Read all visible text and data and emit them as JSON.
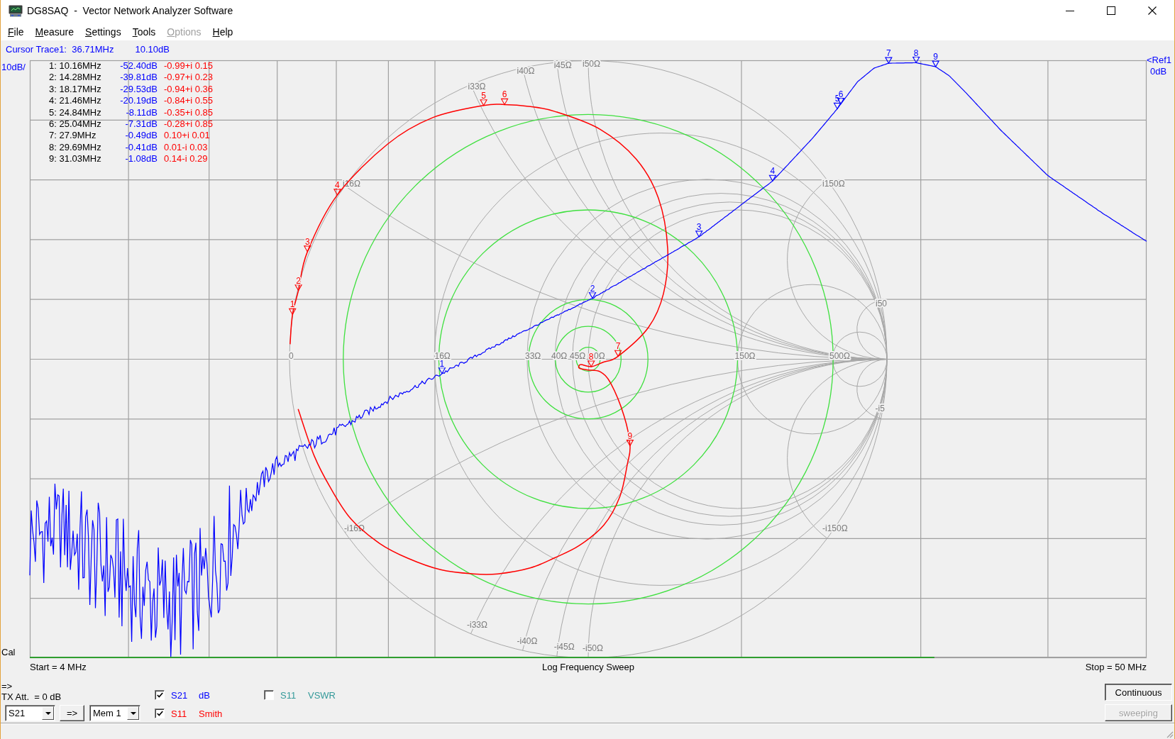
{
  "window": {
    "title": "DG8SAQ  -  Vector Network Analyzer Software"
  },
  "menu": [
    {
      "label": "File",
      "disabled": false
    },
    {
      "label": "Measure",
      "disabled": false
    },
    {
      "label": "Settings",
      "disabled": false
    },
    {
      "label": "Tools",
      "disabled": false
    },
    {
      "label": "Options",
      "disabled": true
    },
    {
      "label": "Help",
      "disabled": false
    }
  ],
  "cursor": {
    "label": "Cursor Trace1:  36.71MHz",
    "value": "10.10dB"
  },
  "axes": {
    "scale": "10dB/",
    "reference": [
      "<Ref1",
      "0dB"
    ],
    "cal": "Cal"
  },
  "marker_table": {
    "rows": [
      {
        "column_1": "1: 10.16MHz",
        "column_2": "-52.40dB",
        "column_3": "-0.99+i 0.15"
      },
      {
        "column_1": "2: 14.28MHz",
        "column_2": "-39.81dB",
        "column_3": "-0.97+i 0.23"
      },
      {
        "column_1": "3: 18.17MHz",
        "column_2": "-29.53dB",
        "column_3": "-0.94+i 0.36"
      },
      {
        "column_1": "4: 21.46MHz",
        "column_2": "-20.19dB",
        "column_3": "-0.84+i 0.55"
      },
      {
        "column_1": "5: 24.84MHz",
        "column_2": "-8.11dB",
        "column_3": "-0.35+i 0.85"
      },
      {
        "column_1": "6: 25.04MHz",
        "column_2": "-7.31dB",
        "column_3": "-0.28+i 0.85"
      },
      {
        "column_1": "7: 27.9MHz",
        "column_2": "-0.49dB",
        "column_3": "0.10+i 0.01"
      },
      {
        "column_1": "8: 29.69MHz",
        "column_2": "-0.41dB",
        "column_3": "0.01-i 0.03"
      },
      {
        "column_1": "9: 31.03MHz",
        "column_2": "-1.08dB",
        "column_3": "0.14-i 0.29"
      }
    ]
  },
  "plot": {
    "s21_markers": [
      "1",
      "2",
      "3",
      "4",
      "5",
      "6",
      "7",
      "8",
      "9"
    ],
    "s11_markers": [
      "1",
      "2",
      "3",
      "4",
      "5",
      "6",
      "7",
      "8",
      "9"
    ],
    "impedance_labels": {
      "real": [
        "0",
        "16Ω",
        "33Ω",
        "40Ω",
        "45Ω",
        "0Ω",
        "150Ω",
        "500Ω"
      ],
      "reactance": [
        "i16Ω",
        "i33Ω",
        "i40Ω",
        "i45Ω",
        "i50Ω",
        "i150Ω",
        "i50",
        "-i16Ω",
        "-i33Ω",
        "-i40Ω",
        "-i45Ω",
        "-i50Ω",
        "-i150Ω",
        "-i5"
      ]
    }
  },
  "sweep": {
    "start": "Start = 4 MHz",
    "mode": "Log Frequency Sweep",
    "stop": "Stop = 50 MHz",
    "progress": {
      "level": 0.81
    }
  },
  "controls": {
    "arrow": "=>",
    "tx_attenuation": "TX Att.  = 0 dB",
    "trace_select": {
      "value": "S21"
    },
    "copy_button": "=>",
    "memory_select": {
      "value": "Mem 1"
    }
  },
  "trace_toggles": [
    {
      "parameter": "S21",
      "format": "dB",
      "checked": true,
      "color": "#0000ff"
    },
    {
      "parameter": "S11",
      "format": "Smith",
      "checked": true,
      "color": "#ff0000"
    },
    {
      "parameter": "S11",
      "format": "VSWR",
      "checked": false,
      "color": "#339999"
    }
  ],
  "sweep_buttons": [
    {
      "label": "Continuous",
      "pressed": true,
      "disabled": false
    },
    {
      "label": "sweeping",
      "pressed": false,
      "disabled": true
    }
  ]
}
